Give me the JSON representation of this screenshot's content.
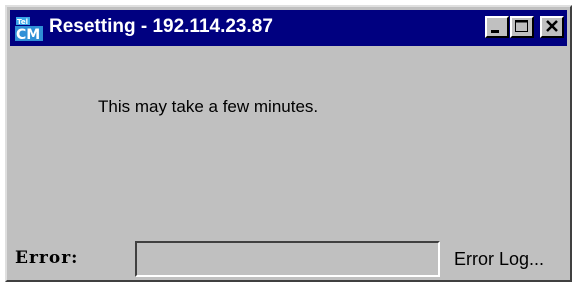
{
  "window": {
    "title": "Resetting - 192.114.23.87",
    "icon": "cm-app-icon",
    "icon_text": "CM",
    "icon_small_text": "Tel",
    "controls": {
      "minimize_icon": "minimize-icon",
      "maximize_icon": "maximize-icon",
      "close_icon": "close-icon"
    }
  },
  "body": {
    "message": "This may take a few minutes."
  },
  "footer": {
    "error_label": "Error:",
    "error_value": "",
    "error_log_label": "Error Log..."
  },
  "colors": {
    "titlebar": "#000080",
    "face": "#c0c0c0",
    "title_text": "#ffffff",
    "icon_accent": "#3aa6e8"
  }
}
